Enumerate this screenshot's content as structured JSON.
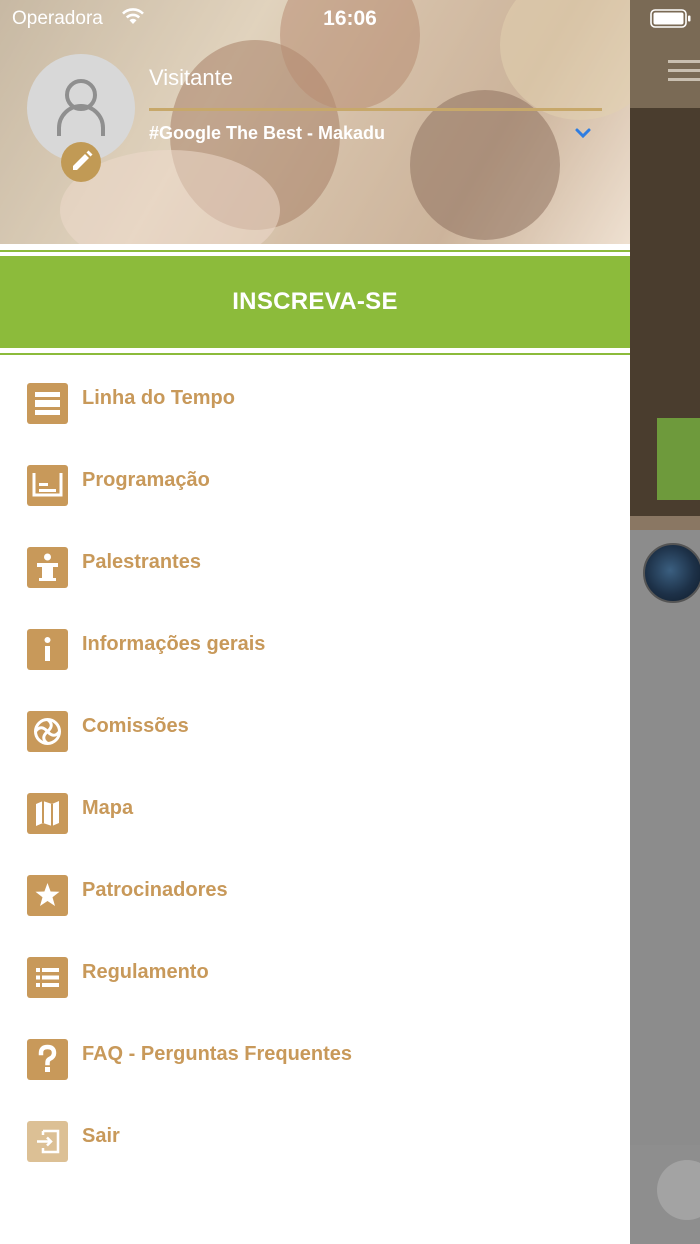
{
  "status_bar": {
    "carrier": "Operadora",
    "time": "16:06"
  },
  "drawer": {
    "user": {
      "name": "Visitante",
      "event": "#Google The Best - Makadu"
    },
    "cta_label": "INSCREVA-SE",
    "menu": [
      {
        "label": "Linha do Tempo",
        "icon": "timeline-icon"
      },
      {
        "label": "Programação",
        "icon": "schedule-icon"
      },
      {
        "label": "Palestrantes",
        "icon": "speaker-podium-icon"
      },
      {
        "label": "Informações gerais",
        "icon": "info-icon"
      },
      {
        "label": "Comissões",
        "icon": "committees-icon"
      },
      {
        "label": "Mapa",
        "icon": "map-icon"
      },
      {
        "label": "Patrocinadores",
        "icon": "star-icon"
      },
      {
        "label": "Regulamento",
        "icon": "list-icon"
      },
      {
        "label": "FAQ - Perguntas Frequentes",
        "icon": "question-icon"
      },
      {
        "label": "Sair",
        "icon": "logout-icon"
      }
    ]
  },
  "colors": {
    "accent_gold": "#c8995a",
    "cta_green": "#8cbb3b",
    "scrim_gray": "#9a9a9a"
  }
}
